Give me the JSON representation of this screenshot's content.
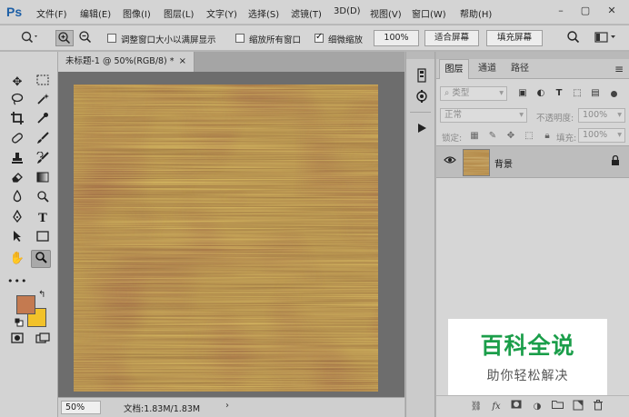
{
  "app": {
    "logo": "Ps"
  },
  "menubar": {
    "items": [
      "文件(F)",
      "编辑(E)",
      "图像(I)",
      "图层(L)",
      "文字(Y)",
      "选择(S)",
      "滤镜(T)",
      "3D(D)",
      "视图(V)",
      "窗口(W)",
      "帮助(H)"
    ],
    "window_controls": {
      "minimize": "–",
      "restore": "▢",
      "close": "✕"
    }
  },
  "options": {
    "resize_windows": {
      "label": "调整窗口大小以满屏显示",
      "checked": false
    },
    "zoom_all_windows": {
      "label": "缩放所有窗口",
      "checked": false
    },
    "scrubby_zoom": {
      "label": "细微缩放",
      "checked": true
    },
    "zoom_100_label": "100%",
    "fit_screen_label": "适合屏幕",
    "fill_screen_label": "填充屏幕"
  },
  "document": {
    "tab_title": "未标题-1 @ 50%(RGB/8) *",
    "tab_close": "×",
    "zoom": "50%",
    "doc_info": "文档:1.83M/1.83M",
    "status_arrow": "›"
  },
  "colors": {
    "foreground": "#c47a50",
    "background": "#f2c22a",
    "artwork_base": "#b28c4e"
  },
  "layers_panel": {
    "tabs": [
      "图层",
      "通道",
      "路径"
    ],
    "active_tab": 0,
    "menu_icon": "≡",
    "filter_kind": "类型",
    "blend_mode": "正常",
    "opacity_label": "不透明度:",
    "opacity_value": "100%",
    "lock_label": "锁定:",
    "fill_label": "填充:",
    "fill_value": "100%",
    "layers": [
      {
        "name": "背景",
        "visible": true,
        "locked": true
      }
    ]
  },
  "watermark": {
    "title": "百科全说",
    "subtitle": "助你轻松解决"
  }
}
